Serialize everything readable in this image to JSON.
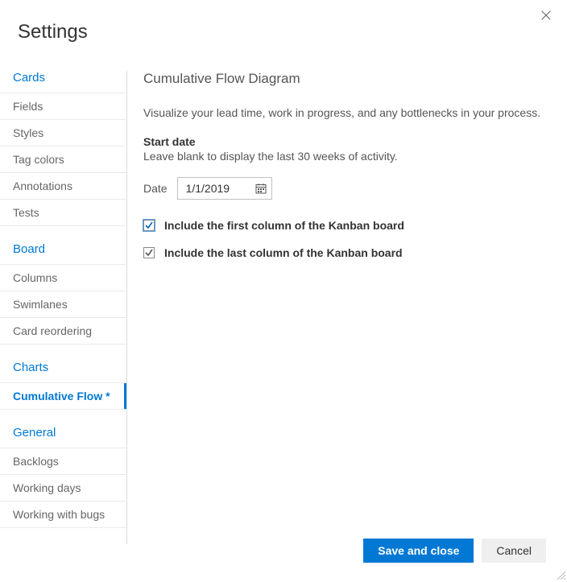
{
  "header": {
    "title": "Settings"
  },
  "sidebar": {
    "sections": [
      {
        "title": "Cards",
        "items": [
          {
            "label": "Fields"
          },
          {
            "label": "Styles"
          },
          {
            "label": "Tag colors"
          },
          {
            "label": "Annotations"
          },
          {
            "label": "Tests"
          }
        ]
      },
      {
        "title": "Board",
        "items": [
          {
            "label": "Columns"
          },
          {
            "label": "Swimlanes"
          },
          {
            "label": "Card reordering"
          }
        ]
      },
      {
        "title": "Charts",
        "items": [
          {
            "label": "Cumulative Flow *",
            "active": true
          }
        ]
      },
      {
        "title": "General",
        "items": [
          {
            "label": "Backlogs"
          },
          {
            "label": "Working days"
          },
          {
            "label": "Working with bugs"
          }
        ]
      }
    ]
  },
  "content": {
    "title": "Cumulative Flow Diagram",
    "description": "Visualize your lead time, work in progress, and any bottlenecks in your process.",
    "startDateLabel": "Start date",
    "startDateHint": "Leave blank to display the last 30 weeks of activity.",
    "dateLabel": "Date",
    "dateValue": "1/1/2019",
    "includeFirstLabel": "Include the first column of the Kanban board",
    "includeLastLabel": "Include the last column of the Kanban board",
    "includeFirstChecked": true,
    "includeLastChecked": true
  },
  "footer": {
    "saveLabel": "Save and close",
    "cancelLabel": "Cancel"
  }
}
